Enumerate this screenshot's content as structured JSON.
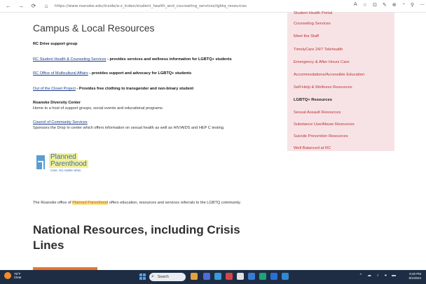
{
  "browser": {
    "url": "https://www.roanoke.edu/inside/a-z_index/student_health_and_counseling_services/lgbtq_resources",
    "back": "←",
    "forward": "→",
    "reload": "⟳",
    "home": "⌂",
    "toolbar_icons": [
      "A",
      "☆",
      "⊡",
      "✎",
      "⊕",
      "◔",
      "⚲",
      "⋯"
    ]
  },
  "main": {
    "campus_heading": "Campus & Local Resources",
    "rc_drive": "RC Drive support group",
    "rc_health_link": "RC Student Health & Counseling Services",
    "rc_health_desc": " - provides services and wellness information for LGBTQ+ students",
    "rc_multicultural_link": "RC Office of Multicultural Affairs",
    "rc_multicultural_desc": " - provides support and advocacy for LGBTQ+ students",
    "closet_link": "Out of the Closet Project",
    "closet_desc": " - Provides free clothing to transgender and non-binary student",
    "diversity_title": "Roanoke Diversity Center",
    "diversity_desc": "Home to a host of support groups, social events and educational programs.",
    "council_link": "Council of Community Services",
    "council_desc": "Sponsors the Drop In center which offers information on sexual health as well as HIV/AIDS and HEP C testing.",
    "pp_line1": "Planned",
    "pp_line2": "Parenthood",
    "pp_tagline": "Care. No matter what.",
    "roanoke_para_pre": "The Roanoke office of ",
    "roanoke_para_hl": "Planned Parenthood",
    "roanoke_para_post": " offers education, resources and services referrals to the LGBTQ community.",
    "national_heading": "National Resources, including Crisis Lines"
  },
  "sidebar": {
    "items": [
      {
        "label": "Student Health Portal",
        "active": false
      },
      {
        "label": "Counseling Services",
        "active": false
      },
      {
        "label": "Meet the Staff",
        "active": false
      },
      {
        "label": "TimelyCare 24/7 Telehealth",
        "active": false
      },
      {
        "label": "Emergency & After Hours Care",
        "active": false
      },
      {
        "label": "Accommodations/Accessible Education",
        "active": false
      },
      {
        "label": "Self-Help & Wellness Resources",
        "active": false
      },
      {
        "label": "LGBTQ+ Resources",
        "active": true
      },
      {
        "label": "Sexual Assault Resources",
        "active": false
      },
      {
        "label": "Substance Use/Abuse Resources",
        "active": false
      },
      {
        "label": "Suicide Prevention Resources",
        "active": false
      },
      {
        "label": "Well Balanced at RC",
        "active": false
      }
    ]
  },
  "taskbar": {
    "weather_temp": "76°F",
    "weather_desc": "Clear",
    "search_placeholder": "Search",
    "clock_time": "8:40 PM",
    "clock_date": "5/1/2024",
    "tray": "^ ☁ ♪ ◂ ▬"
  },
  "colors": {
    "sidebar_bg": "#f7e3e6",
    "sidebar_link": "#b83535",
    "accent_orange": "#e8742c",
    "link_blue": "#1a3c8c"
  }
}
